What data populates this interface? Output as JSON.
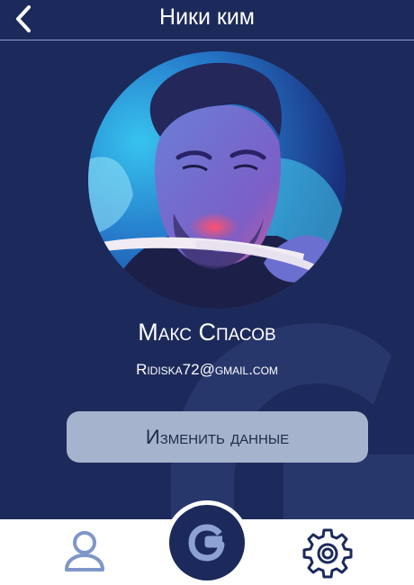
{
  "header": {
    "title": "Ники ким"
  },
  "profile": {
    "name": "Макс Спасов",
    "email": "Ridiska72@gmail.com"
  },
  "actions": {
    "edit_label": "Изменить данные"
  },
  "bottom_nav": {
    "items": [
      {
        "icon": "user-icon"
      },
      {
        "icon": "g-logo-icon"
      },
      {
        "icon": "gear-icon"
      }
    ]
  },
  "colors": {
    "background": "#1c2a5b",
    "button": "#a6b3cc",
    "nav_icon": "#7f96c8",
    "nav_bar": "#ffffff"
  }
}
